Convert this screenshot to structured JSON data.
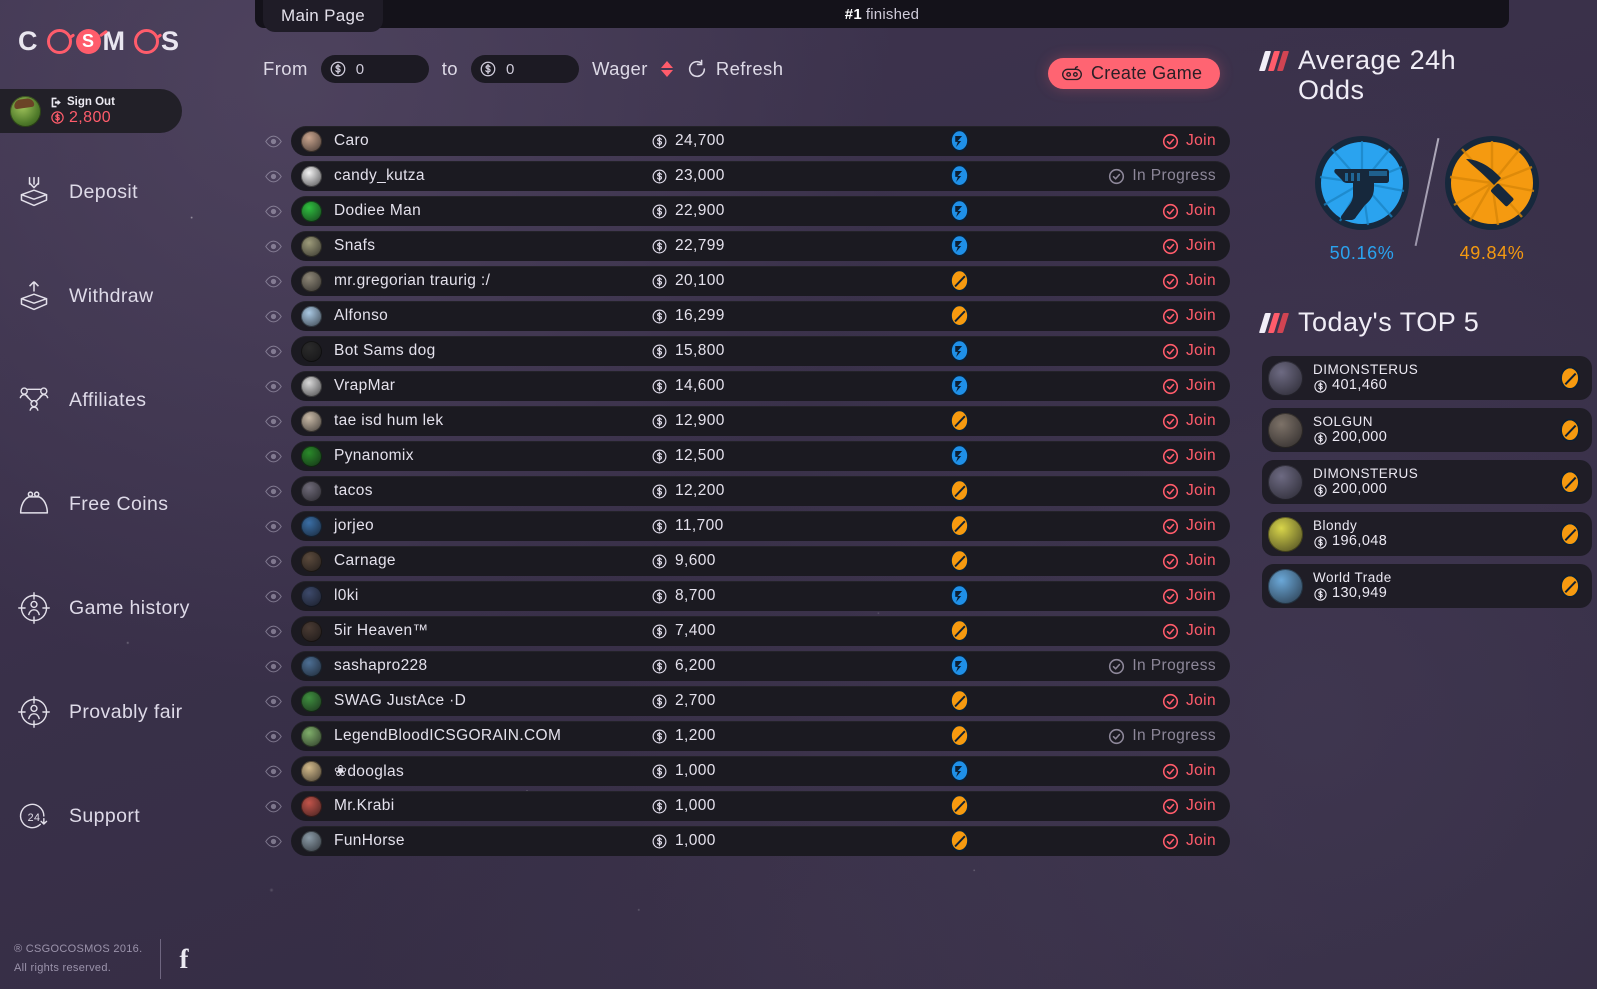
{
  "brand": {
    "name": "COSMOS",
    "letters": [
      "C",
      "O",
      "S",
      "M",
      "O",
      "S"
    ]
  },
  "topbar": {
    "tab_label": "Main Page",
    "status_number": "#1",
    "status_text": "finished"
  },
  "profile": {
    "sign_out_label": "Sign Out",
    "balance": "2,800",
    "avatar_icon": "user-avatar"
  },
  "sidebar": {
    "items": [
      {
        "label": "Deposit",
        "icon": "deposit-icon"
      },
      {
        "label": "Withdraw",
        "icon": "withdraw-icon"
      },
      {
        "label": "Affiliates",
        "icon": "affiliates-icon"
      },
      {
        "label": "Free Coins",
        "icon": "free-coins-icon"
      },
      {
        "label": "Game history",
        "icon": "game-history-icon"
      },
      {
        "label": "Provably fair",
        "icon": "provably-fair-icon"
      },
      {
        "label": "Support",
        "icon": "support-24-icon"
      }
    ]
  },
  "footer": {
    "line1": "® CSGOCOSMOS 2016.",
    "line2": "All rights reserved.",
    "facebook_label": "f"
  },
  "filters": {
    "from_label": "From",
    "from_value": "0",
    "to_label": "to",
    "to_value": "0",
    "wager_label": "Wager",
    "sort_icon": "sort-updown-icon",
    "refresh_label": "Refresh",
    "refresh_icon": "refresh-icon",
    "create_game_label": "Create Game",
    "create_game_icon": "gamepad-icon",
    "coin_icon": "coin-icon"
  },
  "games": {
    "rows": [
      {
        "player": "Caro",
        "amount": "24,700",
        "side": "ct",
        "status": "join",
        "status_label": "Join",
        "avatar_color": "#c9a48d"
      },
      {
        "player": "candy_kutza",
        "amount": "23,000",
        "side": "ct",
        "status": "in_progress",
        "status_label": "In Progress",
        "avatar_color": "#f2f2f2"
      },
      {
        "player": "Dodiee Man",
        "amount": "22,900",
        "side": "ct",
        "status": "join",
        "status_label": "Join",
        "avatar_color": "#2fbf3f"
      },
      {
        "player": "Snafs",
        "amount": "22,799",
        "side": "ct",
        "status": "join",
        "status_label": "Join",
        "avatar_color": "#9d9b7a"
      },
      {
        "player": "mr.gregorian traurig :/",
        "amount": "20,100",
        "side": "t",
        "status": "join",
        "status_label": "Join",
        "avatar_color": "#8d8676"
      },
      {
        "player": "Alfonso",
        "amount": "16,299",
        "side": "t",
        "status": "join",
        "status_label": "Join",
        "avatar_color": "#a9c8e2"
      },
      {
        "player": "Bot Sams dog",
        "amount": "15,800",
        "side": "ct",
        "status": "join",
        "status_label": "Join",
        "avatar_color": "#2b2b2b"
      },
      {
        "player": "VrapMar",
        "amount": "14,600",
        "side": "ct",
        "status": "join",
        "status_label": "Join",
        "avatar_color": "#d8d8d8"
      },
      {
        "player": "tae isd hum lek",
        "amount": "12,900",
        "side": "t",
        "status": "join",
        "status_label": "Join",
        "avatar_color": "#c8b9a6"
      },
      {
        "player": "Pynanomix",
        "amount": "12,500",
        "side": "ct",
        "status": "join",
        "status_label": "Join",
        "avatar_color": "#2a8a2a"
      },
      {
        "player": "tacos",
        "amount": "12,200",
        "side": "t",
        "status": "join",
        "status_label": "Join",
        "avatar_color": "#6e6a78"
      },
      {
        "player": "jorjeo",
        "amount": "11,700",
        "side": "t",
        "status": "join",
        "status_label": "Join",
        "avatar_color": "#3a6ea5"
      },
      {
        "player": "Carnage",
        "amount": "9,600",
        "side": "t",
        "status": "join",
        "status_label": "Join",
        "avatar_color": "#5b4a3c"
      },
      {
        "player": "l0ki",
        "amount": "8,700",
        "side": "ct",
        "status": "join",
        "status_label": "Join",
        "avatar_color": "#3d4a6b"
      },
      {
        "player": "5ir Heaven™",
        "amount": "7,400",
        "side": "t",
        "status": "join",
        "status_label": "Join",
        "avatar_color": "#4a3b33"
      },
      {
        "player": "sashapro228",
        "amount": "6,200",
        "side": "ct",
        "status": "in_progress",
        "status_label": "In Progress",
        "avatar_color": "#4d6f94"
      },
      {
        "player": "SWAG JustAce ·D",
        "amount": "2,700",
        "side": "t",
        "status": "join",
        "status_label": "Join",
        "avatar_color": "#3f8f3f"
      },
      {
        "player": "LegendBloodICSGORAIN.COM",
        "amount": "1,200",
        "side": "t",
        "status": "in_progress",
        "status_label": "In Progress",
        "avatar_color": "#7fae6a"
      },
      {
        "player": "❀dooglas",
        "amount": "1,000",
        "side": "ct",
        "status": "join",
        "status_label": "Join",
        "avatar_color": "#d2b98a"
      },
      {
        "player": "Mr.Krabi",
        "amount": "1,000",
        "side": "t",
        "status": "join",
        "status_label": "Join",
        "avatar_color": "#c2544a"
      },
      {
        "player": "FunHorse",
        "amount": "1,000",
        "side": "t",
        "status": "join",
        "status_label": "Join",
        "avatar_color": "#8a9aa6"
      }
    ]
  },
  "odds": {
    "title_line1": "Average 24h",
    "title_line2": "Odds",
    "ct": {
      "icon": "pistol-icon",
      "percent": "50.16%",
      "color": "#2aa3ef"
    },
    "t": {
      "icon": "knife-icon",
      "percent": "49.84%",
      "color": "#f59a10"
    }
  },
  "top5": {
    "title": "Today's TOP 5",
    "rows": [
      {
        "name": "DIMONSTERUS",
        "amount": "401,460",
        "side": "t",
        "avatar_color": "#6d6a82"
      },
      {
        "name": "SOLGUN",
        "amount": "200,000",
        "side": "t",
        "avatar_color": "#7d7268"
      },
      {
        "name": "DIMONSTERUS",
        "amount": "200,000",
        "side": "t",
        "avatar_color": "#6d6a82"
      },
      {
        "name": "Blondy",
        "amount": "196,048",
        "side": "t",
        "avatar_color": "#d8d54a"
      },
      {
        "name": "World Trade",
        "amount": "130,949",
        "side": "t",
        "avatar_color": "#6ba8d8"
      }
    ]
  },
  "colors": {
    "accent_red": "#ff5c6b",
    "ct_blue": "#2aa3ef",
    "t_orange": "#f59a10",
    "background": "#3a3146",
    "panel": "#1b1a21"
  }
}
